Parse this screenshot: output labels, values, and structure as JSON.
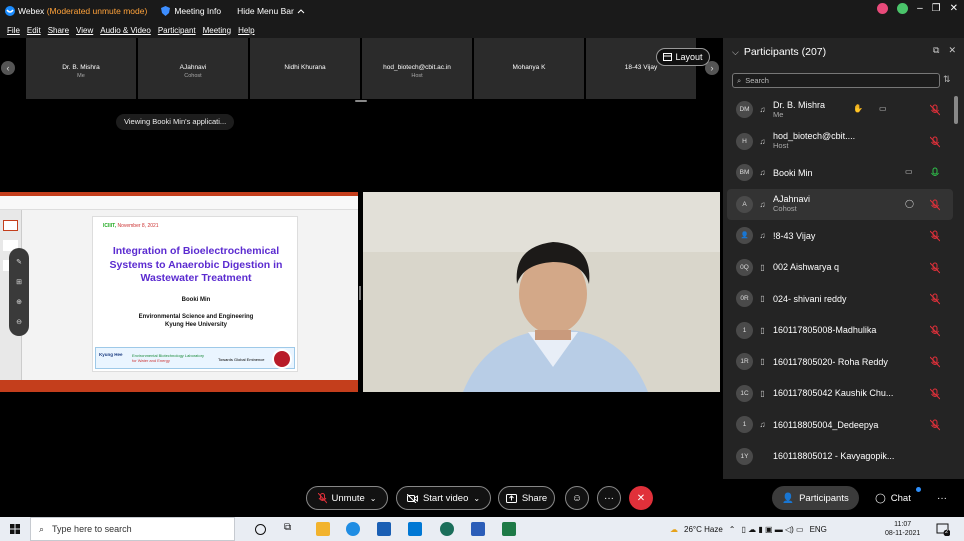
{
  "titlebar": {
    "app_name": "Webex",
    "mode": "(Moderated unmute mode)",
    "meeting_info": "Meeting Info",
    "hide_menu": "Hide Menu Bar"
  },
  "menu": [
    "File",
    "Edit",
    "Share",
    "View",
    "Audio & Video",
    "Participant",
    "Meeting",
    "Help"
  ],
  "thumbnails": [
    {
      "name": "Dr. B. Mishra",
      "role": "Me"
    },
    {
      "name": "AJahnavi",
      "role": "Cohost"
    },
    {
      "name": "Nidhi Khurana",
      "role": ""
    },
    {
      "name": "hod_biotech@cbit.ac.in",
      "role": "Host"
    },
    {
      "name": "Mohanya K",
      "role": ""
    },
    {
      "name": "18-43 Vijay",
      "role": ""
    }
  ],
  "layout_label": "Layout",
  "viewing_text": "Viewing Booki Min's applicati...",
  "slide": {
    "date_a": "ICIIIT,",
    "date_b": "November 8, 2021",
    "heading": "Integration of Bioelectrochemical Systems to Anaerobic Digestion in Wastewater Treatment",
    "author": "Booki Min",
    "affil_1": "Environmental Science and Engineering",
    "affil_2": "Kyung Hee University",
    "footer_logo": "Kyung Hee",
    "footer_lab": "Environmental Biotechnology Laboratory",
    "footer_lab_sub": "for Water and Energy",
    "footer_tag": "Towards Global Eminence"
  },
  "panel": {
    "title": "Participants (207)",
    "search_placeholder": "Search",
    "participants": [
      {
        "initials": "DM",
        "name": "Dr. B. Mishra",
        "sub": "Me",
        "device": "headset",
        "mic": "off",
        "extra": "hand"
      },
      {
        "initials": "H",
        "name": "hod_biotech@cbit....",
        "sub": "Host",
        "device": "headset",
        "mic": "off",
        "extra": ""
      },
      {
        "initials": "BM",
        "name": "Booki Min",
        "sub": "",
        "device": "headset",
        "mic": "on",
        "extra": "video"
      },
      {
        "initials": "A",
        "name": "AJahnavi",
        "sub": "Cohost",
        "device": "headset",
        "mic": "off",
        "extra": "chat"
      },
      {
        "initials": "",
        "name": "!8-43 Vijay",
        "sub": "",
        "device": "headset",
        "mic": "off",
        "extra": ""
      },
      {
        "initials": "0Q",
        "name": "002 Aishwarya q",
        "sub": "",
        "device": "phone",
        "mic": "off",
        "extra": ""
      },
      {
        "initials": "0R",
        "name": "024- shivani reddy",
        "sub": "",
        "device": "phone",
        "mic": "off",
        "extra": ""
      },
      {
        "initials": "1",
        "name": "160117805008-Madhulika",
        "sub": "",
        "device": "phone",
        "mic": "off",
        "extra": ""
      },
      {
        "initials": "1R",
        "name": "160117805020- Roha Reddy",
        "sub": "",
        "device": "phone",
        "mic": "off",
        "extra": ""
      },
      {
        "initials": "1C",
        "name": "160117805042 Kaushik Chu...",
        "sub": "",
        "device": "phone",
        "mic": "off",
        "extra": ""
      },
      {
        "initials": "1",
        "name": "160118805004_Dedeepya",
        "sub": "",
        "device": "headset",
        "mic": "off",
        "extra": ""
      },
      {
        "initials": "1Y",
        "name": "160118805012 - Kavyagopik...",
        "sub": "",
        "device": "",
        "mic": "",
        "extra": ""
      }
    ]
  },
  "controls": {
    "unmute": "Unmute",
    "start_video": "Start video",
    "share": "Share",
    "participants": "Participants",
    "chat": "Chat"
  },
  "taskbar": {
    "search_placeholder": "Type here to search",
    "weather": "26°C Haze",
    "lang": "ENG",
    "time": "11:07",
    "date": "08-11-2021",
    "notifications": "2"
  },
  "colors": {
    "mode_text": "#ffa23a",
    "end_button": "#e0303a",
    "mic_off": "#e0303a",
    "mic_on": "#2fbf4a",
    "slide_heading": "#5b2bd0",
    "ppt_accent": "#c43e1c"
  }
}
